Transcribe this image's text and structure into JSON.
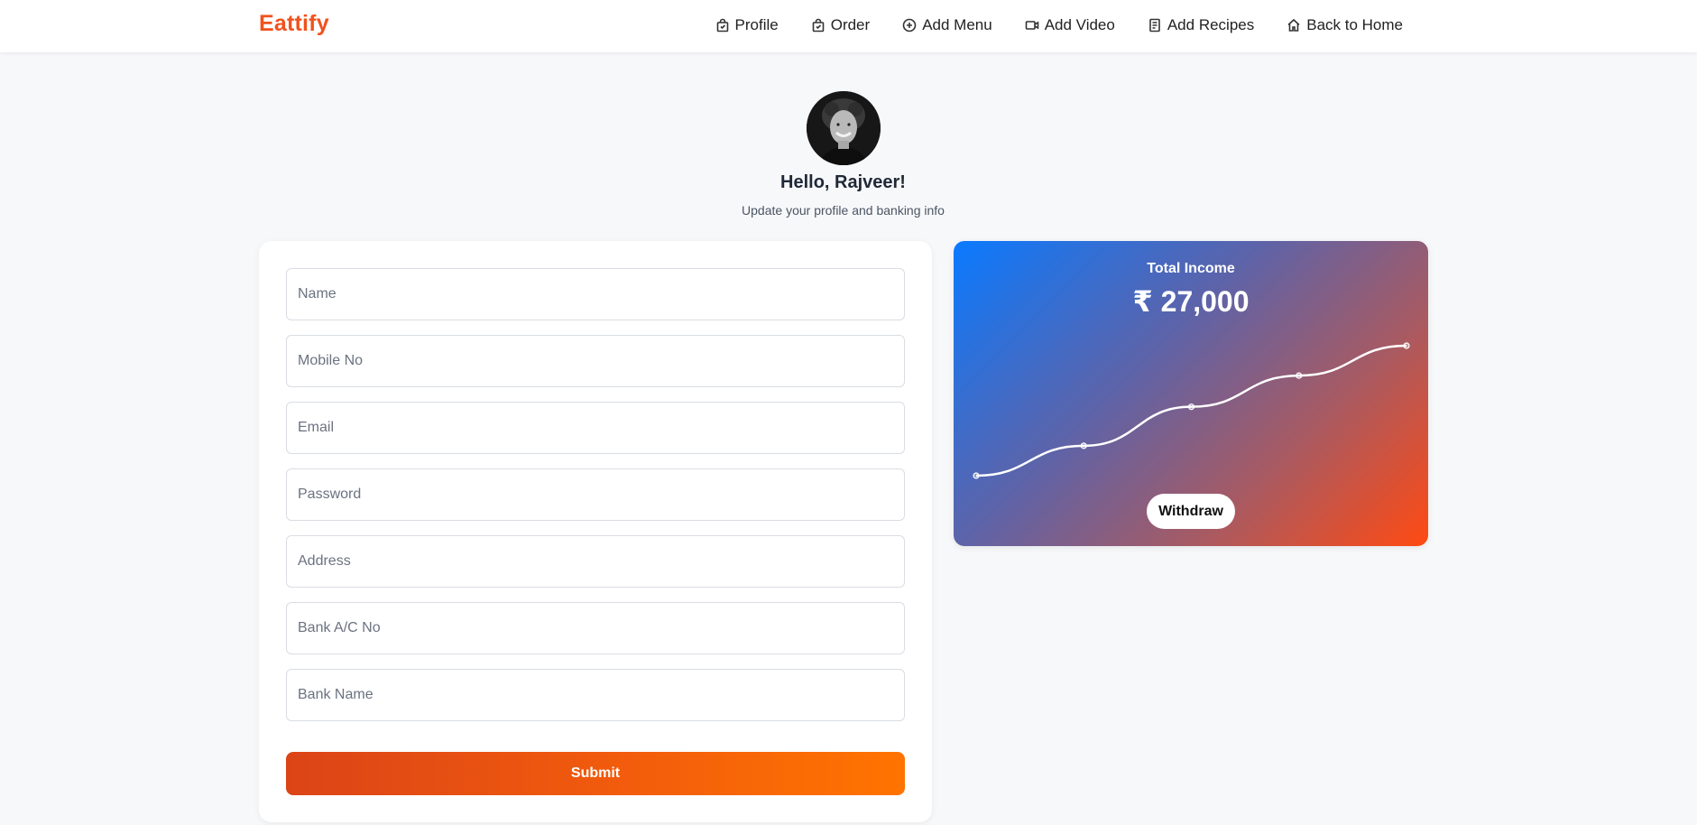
{
  "brand": "Eattify",
  "nav": [
    {
      "label": "Profile",
      "icon": "shopping-bag-icon"
    },
    {
      "label": "Order",
      "icon": "bag-check-icon"
    },
    {
      "label": "Add Menu",
      "icon": "plus-circle-icon"
    },
    {
      "label": "Add Video",
      "icon": "video-camera-icon"
    },
    {
      "label": "Add Recipes",
      "icon": "recipe-list-icon"
    },
    {
      "label": "Back to Home",
      "icon": "home-icon"
    }
  ],
  "profile": {
    "greeting": "Hello, Rajveer!",
    "subtitle": "Update your profile and banking info"
  },
  "form": {
    "fields": [
      {
        "placeholder": "Name",
        "value": ""
      },
      {
        "placeholder": "Mobile No",
        "value": ""
      },
      {
        "placeholder": "Email",
        "value": ""
      },
      {
        "placeholder": "Password",
        "value": ""
      },
      {
        "placeholder": "Address",
        "value": ""
      },
      {
        "placeholder": "Bank A/C No",
        "value": ""
      },
      {
        "placeholder": "Bank Name",
        "value": ""
      }
    ],
    "submit_label": "Submit"
  },
  "income": {
    "title": "Total Income",
    "amount": "₹ 27,000",
    "withdraw_label": "Withdraw"
  },
  "chart_data": {
    "type": "line",
    "x": [
      1,
      2,
      3,
      4,
      5
    ],
    "values": [
      0,
      23,
      53,
      77,
      100
    ],
    "ylim": [
      0,
      100
    ],
    "grid": false,
    "line_color": "#ffffff"
  },
  "colors": {
    "brand": "#f0521e",
    "submit_start": "#db4417",
    "submit_end": "#ff7400",
    "card_gradient_start": "#0a7aff",
    "card_gradient_end": "#ff4a12"
  }
}
